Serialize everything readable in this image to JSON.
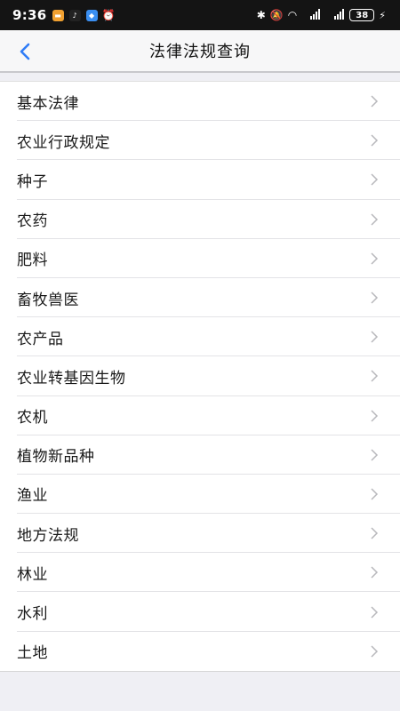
{
  "status_bar": {
    "time": "9:36",
    "battery": "38",
    "signal_1": "4G",
    "signal_2": "4G"
  },
  "navbar": {
    "title": "法律法规查询",
    "back_icon": "chevron-left-icon",
    "accent_color": "#2f7cf6"
  },
  "list": {
    "items": [
      {
        "label": "基本法律"
      },
      {
        "label": "农业行政规定"
      },
      {
        "label": "种子"
      },
      {
        "label": "农药"
      },
      {
        "label": "肥料"
      },
      {
        "label": "畜牧兽医"
      },
      {
        "label": "农产品"
      },
      {
        "label": "农业转基因生物"
      },
      {
        "label": "农机"
      },
      {
        "label": "植物新品种"
      },
      {
        "label": "渔业"
      },
      {
        "label": "地方法规"
      },
      {
        "label": "林业"
      },
      {
        "label": "水利"
      },
      {
        "label": "土地"
      }
    ]
  }
}
